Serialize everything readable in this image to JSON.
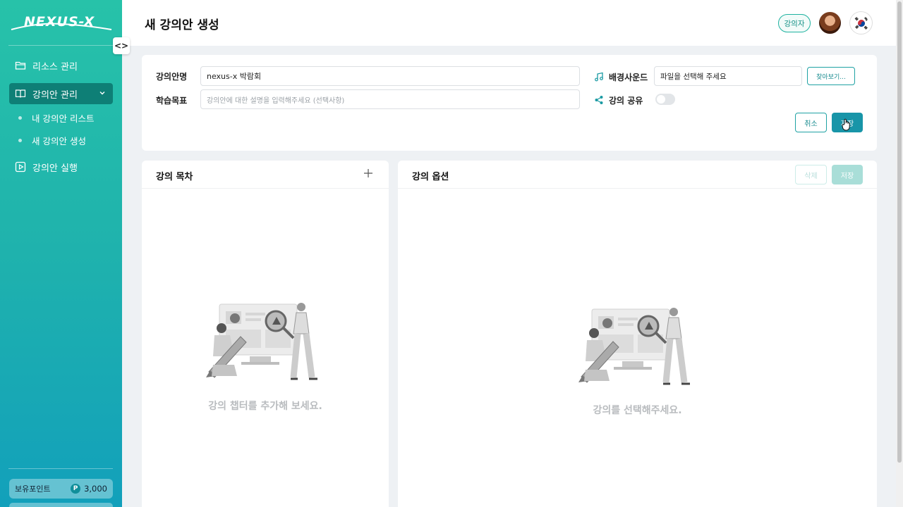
{
  "sidebar": {
    "logo": "NEXUS-X",
    "items": [
      {
        "label": "리소스 관리",
        "icon": "folder-icon"
      },
      {
        "label": "강의안 관리",
        "icon": "book-icon",
        "active": true
      },
      {
        "label": "강의안 실행",
        "icon": "play-icon"
      }
    ],
    "sub_items": [
      {
        "label": "내 강의안 리스트"
      },
      {
        "label": "새 강의안 생성"
      }
    ],
    "points_label": "보유포인트",
    "points_badge": "P",
    "points_value": "3,000",
    "toggle_label": "<>"
  },
  "header": {
    "title": "새 강의안 생성",
    "role_badge": "강의자"
  },
  "form": {
    "name_label": "강의안명",
    "name_value": "nexus-x 박람회",
    "goal_label": "학습목표",
    "goal_placeholder": "강의안에 대한 설명을 입력해주세요 (선택사항)",
    "sound_label": "배경사운드",
    "sound_placeholder": "파일을 선택해 주세요",
    "browse_button": "찾아보기...",
    "share_label": "강의 공유",
    "share_on": false,
    "cancel_button": "취소",
    "save_button": "저장"
  },
  "toc_panel": {
    "title": "강의 목차",
    "add_label": "+",
    "empty_text": "강의 챕터를 추가해 보세요."
  },
  "options_panel": {
    "title": "강의 옵션",
    "delete_button": "삭제",
    "save_button": "저장",
    "empty_text": "강의를 선택해주세요."
  },
  "colors": {
    "accent": "#1895a8",
    "sidebar_top": "#27c2a9",
    "sidebar_bottom": "#12a0bb"
  }
}
